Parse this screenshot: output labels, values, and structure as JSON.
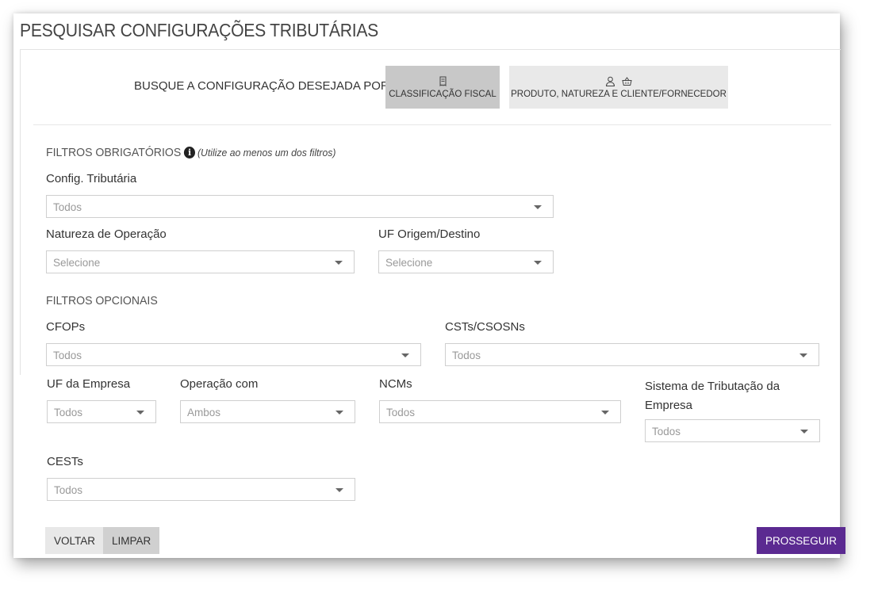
{
  "page": {
    "title": "PESQUISAR CONFIGURAÇÕES TRIBUTÁRIAS"
  },
  "search_mode": {
    "prompt": "BUSQUE A CONFIGURAÇÃO DESEJADA POR...",
    "options": [
      {
        "label": "CLASSIFICAÇÃO FISCAL",
        "icons": [
          "receipt-icon"
        ],
        "active": true
      },
      {
        "label": "PRODUTO, NATUREZA E CLIENTE/FORNECEDOR",
        "icons": [
          "user-icon",
          "basket-icon"
        ],
        "active": false
      }
    ]
  },
  "mandatory_filters": {
    "title": "FILTROS OBRIGATÓRIOS",
    "info_icon": "info-icon",
    "hint": "(Utilize ao menos um dos filtros)",
    "config_tributaria": {
      "label": "Config. Tributária",
      "value": "Todos"
    },
    "natureza_operacao": {
      "label": "Natureza de Operação",
      "value": "Selecione"
    },
    "uf_origem_destino": {
      "label": "UF Origem/Destino",
      "value": "Selecione"
    }
  },
  "optional_filters": {
    "title": "FILTROS OPCIONAIS",
    "cfops": {
      "label": "CFOPs",
      "value": "Todos"
    },
    "csts": {
      "label": "CSTs/CSOSNs",
      "value": "Todos"
    },
    "uf_empresa": {
      "label": "UF da Empresa",
      "value": "Todos"
    },
    "operacao_com": {
      "label": "Operação com",
      "value": "Ambos"
    },
    "ncms": {
      "label": "NCMs",
      "value": "Todos"
    },
    "sistema_tributacao": {
      "label_line1": "Sistema de Tributação da",
      "label_line2": "Empresa",
      "value": "Todos"
    },
    "cests": {
      "label": "CESTs",
      "value": "Todos"
    }
  },
  "actions": {
    "back": "VOLTAR",
    "clear": "LIMPAR",
    "proceed": "PROSSEGUIR"
  },
  "colors": {
    "primary": "#5b2a91",
    "button_grey": "#e8e8e8",
    "active_mode": "#c8c8c8"
  }
}
